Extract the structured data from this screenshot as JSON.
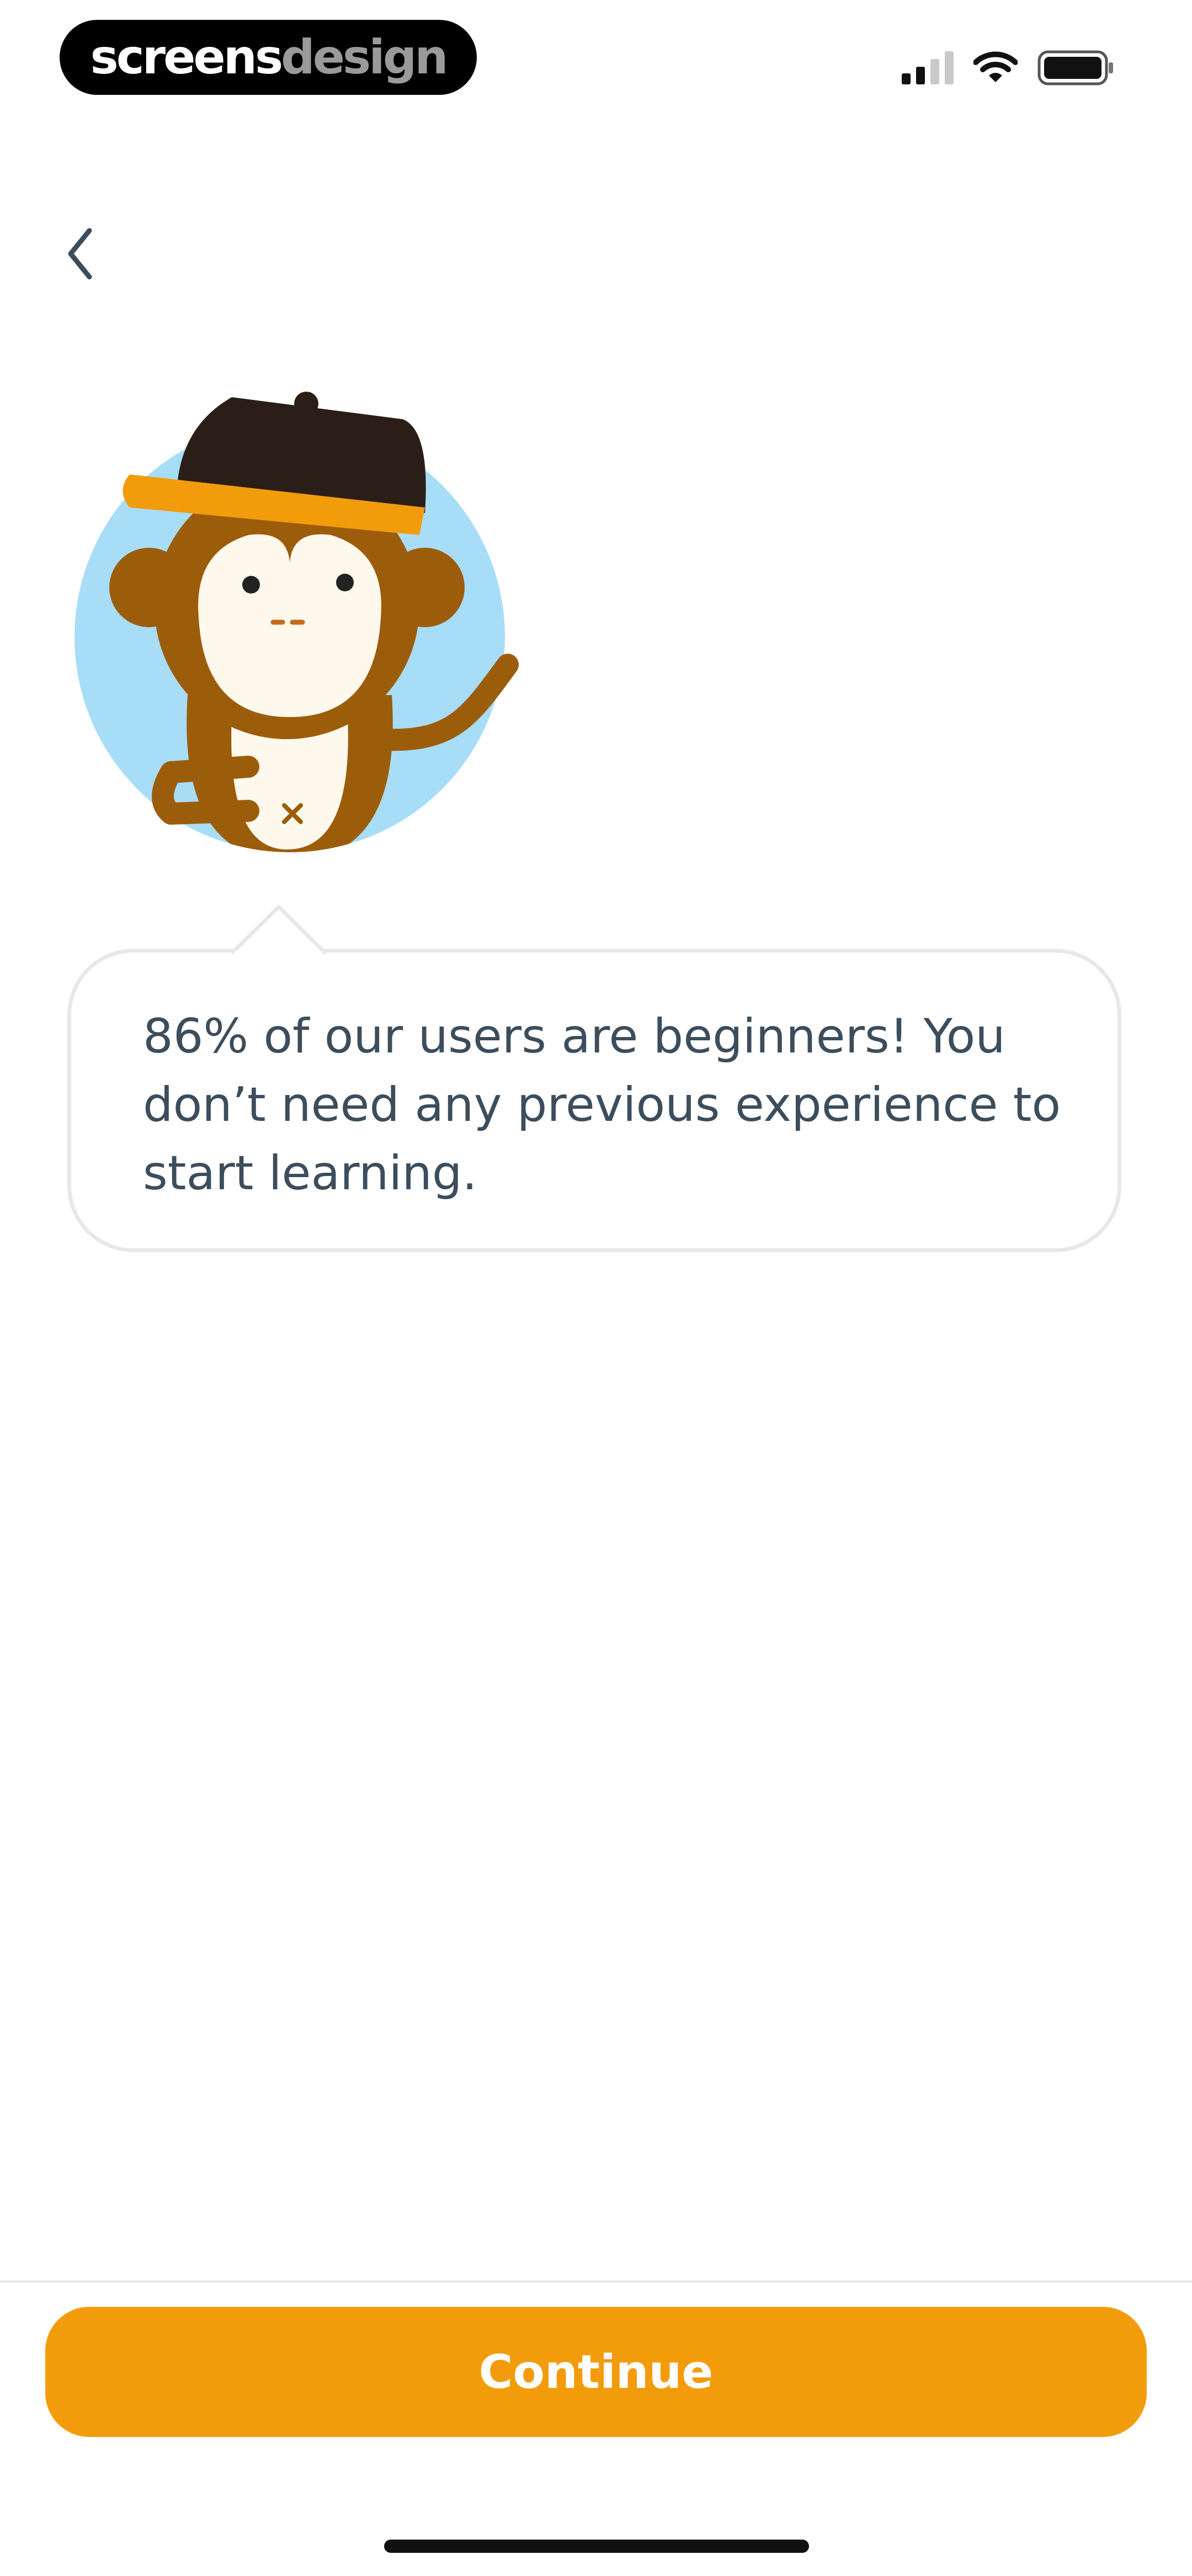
{
  "status_bar": {
    "brand_primary": "screens",
    "brand_secondary": "design",
    "signal_icon": "cellular-signal-icon",
    "wifi_icon": "wifi-icon",
    "battery_icon": "battery-icon"
  },
  "nav": {
    "back_icon": "chevron-left-icon"
  },
  "mascot": {
    "icon": "monkey-mascot-icon"
  },
  "message": {
    "text": "86% of our users are beginners! You don’t need any previous experience to start learning."
  },
  "footer": {
    "continue_label": "Continue"
  },
  "colors": {
    "accent": "#F39C0B",
    "text": "#3C4D5C",
    "mascot_bg": "#A8DDF8",
    "bubble_border": "#E6E8EA"
  }
}
